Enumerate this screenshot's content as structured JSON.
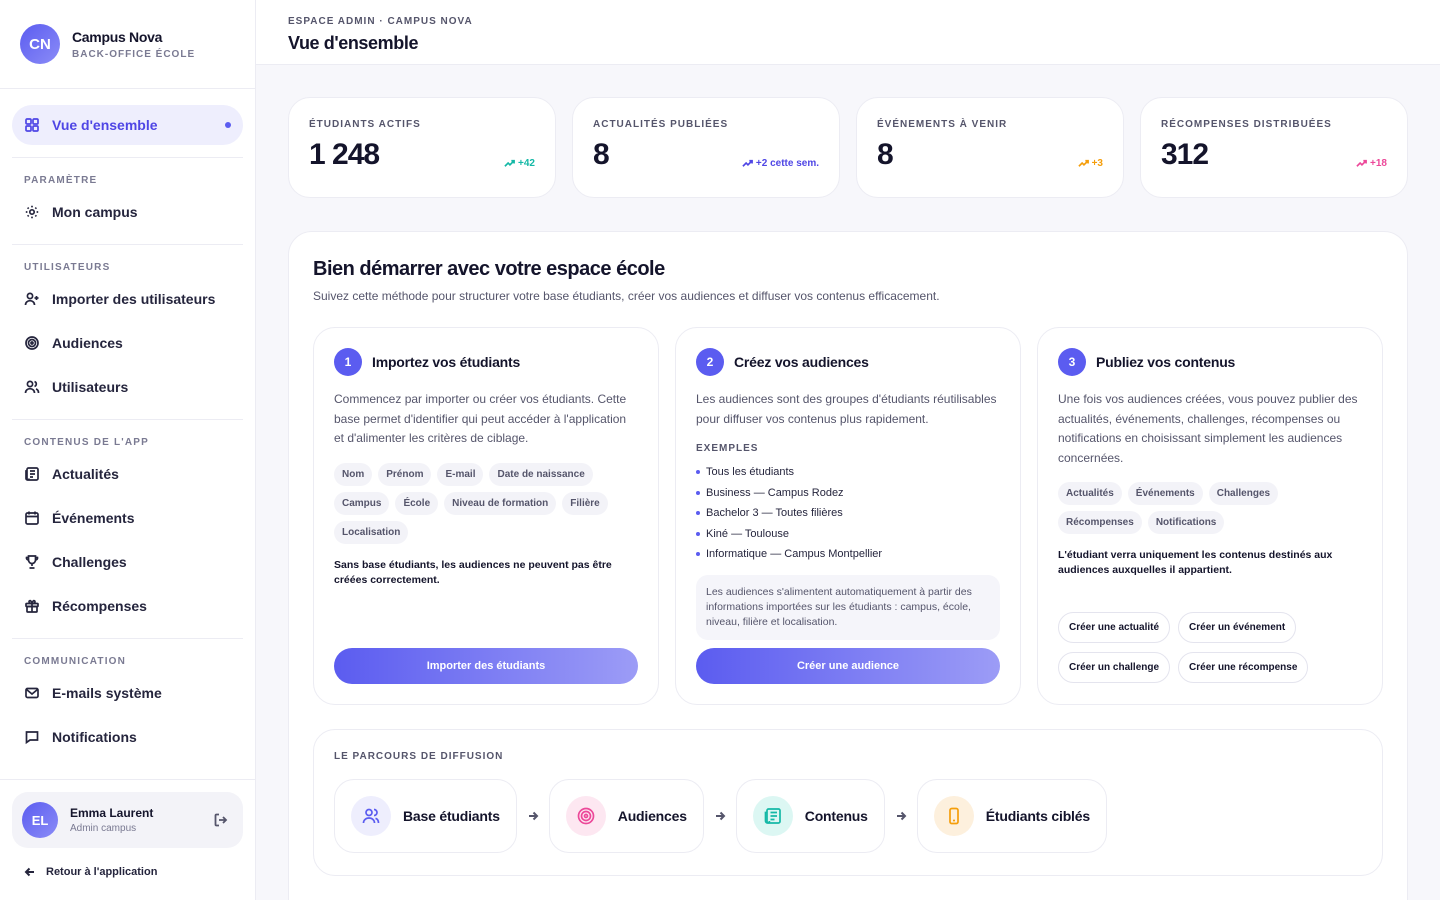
{
  "brand": {
    "logo": "CN",
    "name": "Campus Nova",
    "subtitle": "BACK-OFFICE ÉCOLE"
  },
  "nav": {
    "overview": "Vue d'ensemble",
    "sections": [
      {
        "title": "PARAMÈTRE",
        "items": [
          "Mon campus"
        ]
      },
      {
        "title": "UTILISATEURS",
        "items": [
          "Importer des utilisateurs",
          "Audiences",
          "Utilisateurs"
        ]
      },
      {
        "title": "CONTENUS DE L'APP",
        "items": [
          "Actualités",
          "Événements",
          "Challenges",
          "Récompenses"
        ]
      },
      {
        "title": "COMMUNICATION",
        "items": [
          "E-mails système",
          "Notifications"
        ]
      }
    ]
  },
  "user": {
    "initials": "EL",
    "name": "Emma Laurent",
    "role": "Admin campus"
  },
  "back_link": "Retour à l'application",
  "header": {
    "breadcrumb": "ESPACE ADMIN · CAMPUS NOVA",
    "title": "Vue d'ensemble"
  },
  "kpis": [
    {
      "label": "ÉTUDIANTS ACTIFS",
      "value": "1 248",
      "trend": "+42",
      "color": "#14b8a6"
    },
    {
      "label": "ACTUALITÉS PUBLIÉES",
      "value": "8",
      "trend": "+2 cette sem.",
      "color": "#4f46e5"
    },
    {
      "label": "ÉVÉNEMENTS À VENIR",
      "value": "8",
      "trend": "+3",
      "color": "#f59e0b"
    },
    {
      "label": "RÉCOMPENSES DISTRIBUÉES",
      "value": "312",
      "trend": "+18",
      "color": "#ec4899"
    }
  ],
  "panel": {
    "title": "Bien démarrer avec votre espace école",
    "subtitle": "Suivez cette méthode pour structurer votre base étudiants, créer vos audiences et diffuser vos contenus efficacement."
  },
  "steps": [
    {
      "num": "1",
      "title": "Importez vos étudiants",
      "desc": "Commencez par importer ou créer vos étudiants. Cette base permet d'identifier qui peut accéder à l'application et d'alimenter les critères de ciblage.",
      "chips": [
        "Nom",
        "Prénom",
        "E-mail",
        "Date de naissance",
        "Campus",
        "École",
        "Niveau de formation",
        "Filière",
        "Localisation"
      ],
      "note": "Sans base étudiants, les audiences ne peuvent pas être créées correctement.",
      "button": "Importer des étudiants"
    },
    {
      "num": "2",
      "title": "Créez vos audiences",
      "desc": "Les audiences sont des groupes d'étudiants réutilisables pour diffuser vos contenus plus rapidement.",
      "examples_title": "EXEMPLES",
      "examples": [
        "Tous les étudiants",
        "Business — Campus Rodez",
        "Bachelor 3 — Toutes filières",
        "Kiné — Toulouse",
        "Informatique — Campus Montpellier"
      ],
      "info": "Les audiences s'alimentent automatiquement à partir des informations importées sur les étudiants : campus, école, niveau, filière et localisation.",
      "button": "Créer une audience"
    },
    {
      "num": "3",
      "title": "Publiez vos contenus",
      "desc": "Une fois vos audiences créées, vous pouvez publier des actualités, événements, challenges, récompenses ou notifications en choisissant simplement les audiences concernées.",
      "chips": [
        "Actualités",
        "Événements",
        "Challenges",
        "Récompenses",
        "Notifications"
      ],
      "note": "L'étudiant verra uniquement les contenus destinés aux audiences auxquelles il appartient.",
      "actions": [
        "Créer une actualité",
        "Créer un événement",
        "Créer un challenge",
        "Créer une récompense"
      ]
    }
  ],
  "flow": {
    "title": "LE PARCOURS DE DIFFUSION",
    "items": [
      {
        "label": "Base étudiants",
        "icon": "users-icon",
        "color": "#5b5cf0",
        "bg": "#eeeefd"
      },
      {
        "label": "Audiences",
        "icon": "target-icon",
        "color": "#ec4899",
        "bg": "#fde7f1"
      },
      {
        "label": "Contenus",
        "icon": "newspaper-icon",
        "color": "#14b8a6",
        "bg": "#dcf7f3"
      },
      {
        "label": "Étudiants ciblés",
        "icon": "phone-icon",
        "color": "#f59e0b",
        "bg": "#fdf0dd"
      }
    ]
  }
}
